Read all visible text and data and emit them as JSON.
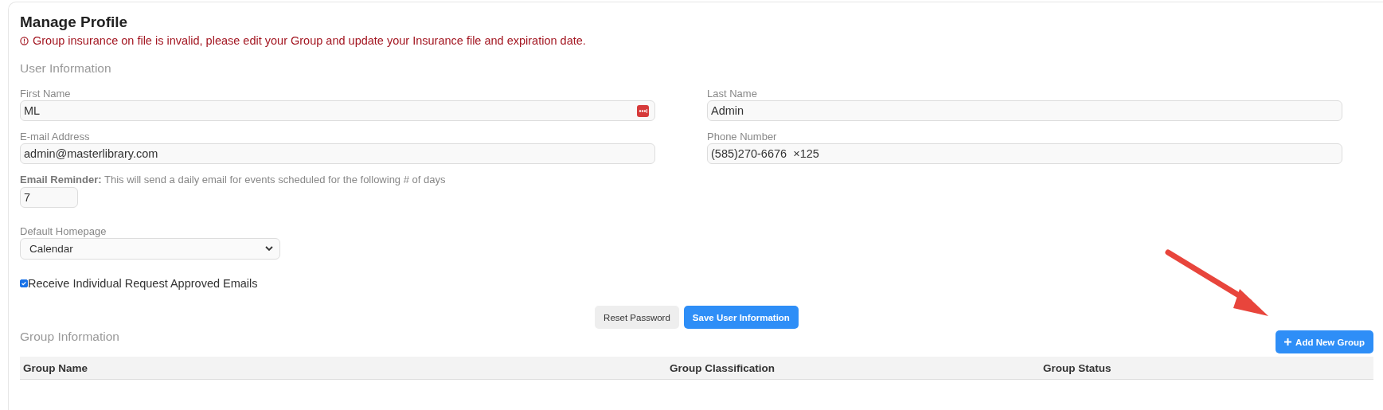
{
  "title": "Manage Profile",
  "alert": "Group insurance on file is invalid, please edit your Group and update your Insurance file and expiration date.",
  "user_section": {
    "heading": "User Information",
    "fields": [
      {
        "label": "First Name",
        "value": "ML",
        "password_manager": true
      },
      {
        "label": "Last Name",
        "value": "Admin",
        "password_manager": false
      },
      {
        "label": "E-mail Address",
        "value": "admin@masterlibrary.com",
        "password_manager": false
      },
      {
        "label": "Phone Number",
        "value": "(585)270-6676  ×125",
        "password_manager": false
      }
    ],
    "reminder": {
      "label": "**Email Reminder:** This will send a daily email for events scheduled for the following # of days",
      "value": "7"
    },
    "homepage": {
      "label": "Default Homepage",
      "value": "Calendar"
    },
    "approved_emails": {
      "label": "Receive Individual Request Approved Emails",
      "checked": true
    },
    "buttons": [
      {
        "label": "Reset Password",
        "kind": "secondary"
      },
      {
        "label": "Save User Information",
        "kind": "primary"
      }
    ]
  },
  "group_section": {
    "heading": "Group Information",
    "add_button": "Add New Group",
    "columns": [
      "Group Name",
      "Group Classification",
      "Group Status"
    ]
  }
}
